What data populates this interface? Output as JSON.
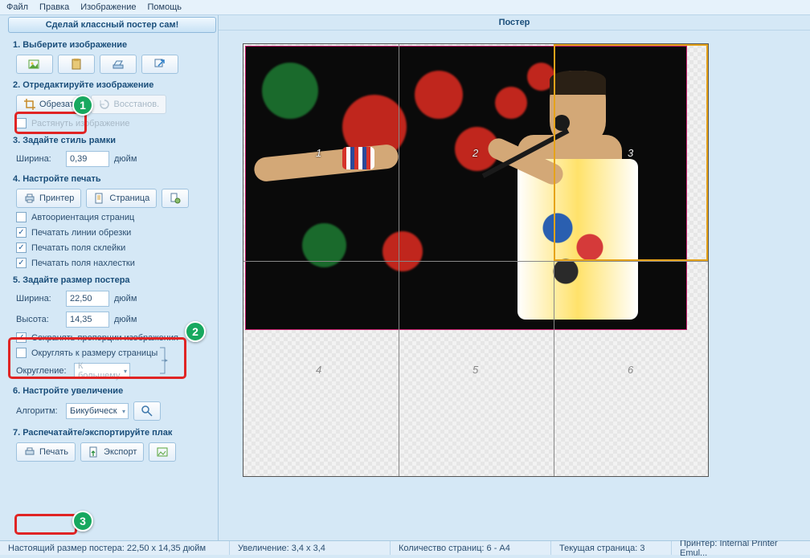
{
  "menu": {
    "file": "Файл",
    "edit": "Правка",
    "image": "Изображение",
    "help": "Помощь"
  },
  "promo": "Сделай классный постер сам!",
  "steps": {
    "s1": "1. Выберите изображение",
    "s2": "2. Отредактируйте изображение",
    "s3": "3. Задайте стиль рамки",
    "s4": "4. Настройте печать",
    "s5": "5. Задайте размер постера",
    "s6": "6. Настройте увеличение",
    "s7": "7. Распечатайте/экспортируйте плак"
  },
  "edit": {
    "crop": "Обрезать",
    "restore": "Восстанов.",
    "stretch": "Растянуть изображение"
  },
  "frame": {
    "width_label": "Ширина:",
    "width_value": "0,39",
    "unit": "дюйм"
  },
  "print": {
    "printer": "Принтер",
    "page": "Страница",
    "auto_orient": "Автоориентация страниц",
    "cut_lines": "Печатать линии обрезки",
    "glue_margins": "Печатать поля склейки",
    "overlap": "Печатать поля нахлестки"
  },
  "size": {
    "width_label": "Ширина:",
    "width_value": "22,50",
    "height_label": "Высота:",
    "height_value": "14,35",
    "unit": "дюйм",
    "keep_ratio": "Сохранять пропорции изображения",
    "round_page": "Округлять к размеру страницы",
    "rounding_label": "Округление:",
    "rounding_value": "К большему"
  },
  "zoom": {
    "algo_label": "Алгоритм:",
    "algo_value": "Бикубическ"
  },
  "export": {
    "print": "Печать",
    "export": "Экспорт"
  },
  "right": {
    "title": "Постер"
  },
  "pagenums": {
    "p1": "1",
    "p2": "2",
    "p3": "3",
    "p4": "4",
    "p5": "5",
    "p6": "6"
  },
  "status": {
    "real_size": "Настоящий размер постера: 22,50 x 14,35 дюйм",
    "enlarge": "Увеличение: 3,4 x 3,4",
    "pages": "Количество страниц: 6 - A4",
    "current": "Текущая страница: 3",
    "printer": "Принтер: Internal Printer Emul..."
  },
  "badges": {
    "b1": "1",
    "b2": "2",
    "b3": "3"
  }
}
